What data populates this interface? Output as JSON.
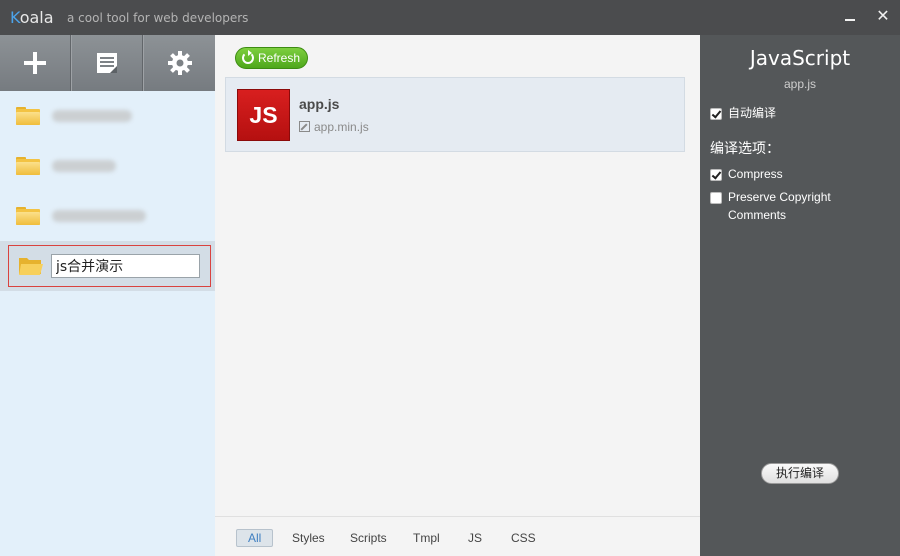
{
  "titlebar": {
    "app_name_first": "K",
    "app_name_rest": "oala",
    "tagline": "a cool tool for web developers",
    "minimize_glyph": "—",
    "close_glyph": "✕"
  },
  "sidebar": {
    "toolbar": [
      {
        "icon": "plus-icon"
      },
      {
        "icon": "notes-icon"
      },
      {
        "icon": "gear-icon"
      }
    ],
    "projects": [
      {
        "label": "",
        "blurred": true
      },
      {
        "label": "",
        "blurred": true
      },
      {
        "label": "",
        "blurred": true
      }
    ],
    "editing_project": {
      "value": "js合并演示"
    }
  },
  "main": {
    "refresh_label": "Refresh",
    "file": {
      "icon_text": "JS",
      "name": "app.js",
      "output": "app.min.js"
    },
    "filters": [
      "All",
      "Styles",
      "Scripts",
      "Tmpl",
      "JS",
      "CSS"
    ],
    "active_filter": "All"
  },
  "settings": {
    "title": "JavaScript",
    "file": "app.js",
    "auto_compile_label": "自动编译",
    "auto_compile": true,
    "options_heading": "编译选项：",
    "compress_label": "Compress",
    "compress": true,
    "preserve_label_line1": "Preserve Copyright",
    "preserve_label_line2": "Comments",
    "preserve": false,
    "compile_button": "执行编译"
  },
  "colors": {
    "titlebar_bg": "#4b4c4e",
    "sidebar_bg": "#e3f0fa",
    "right_panel_bg": "#545759",
    "refresh_green": "#5cb82a",
    "js_red": "#c81818",
    "selection_border": "#d9423f"
  }
}
